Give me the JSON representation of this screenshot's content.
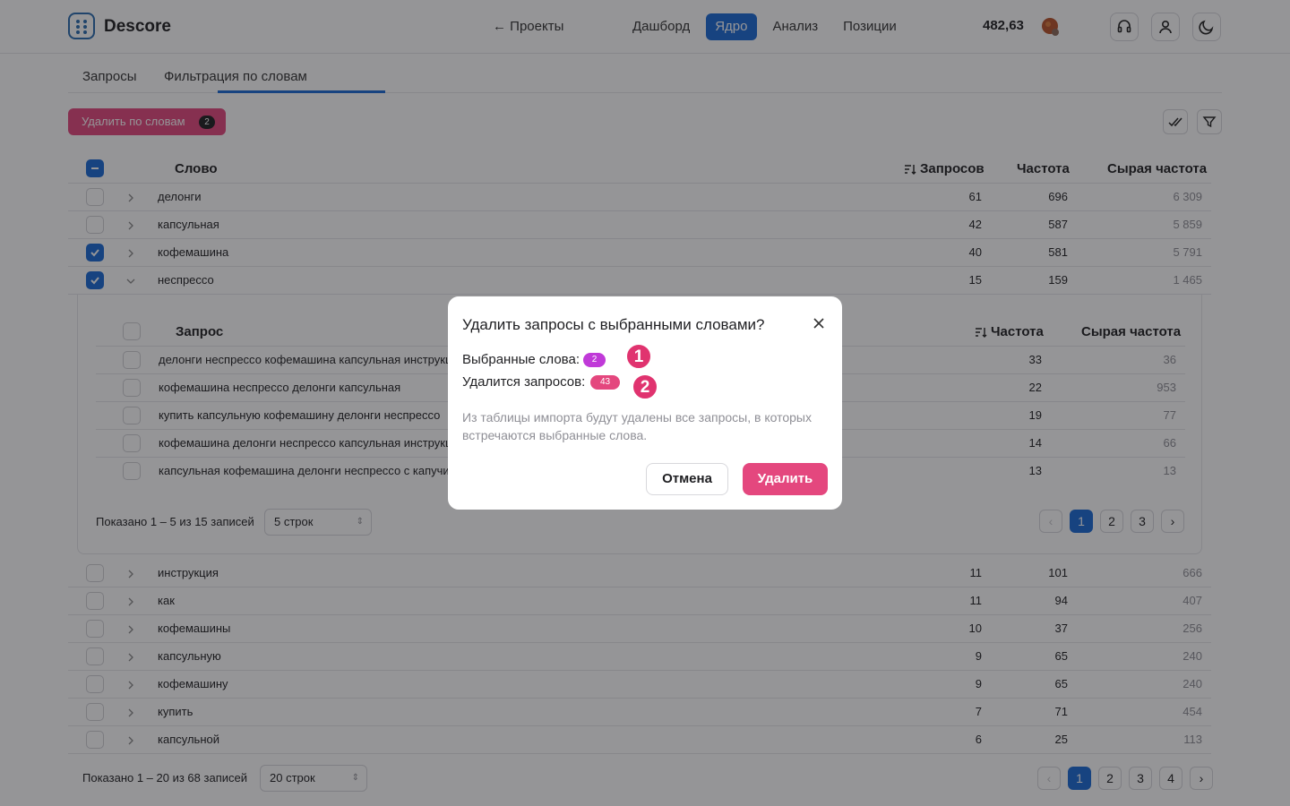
{
  "header": {
    "brand": "Descore",
    "back_link": "← Проекты",
    "nav": [
      "Дашборд",
      "Ядро",
      "Анализ",
      "Позиции"
    ],
    "active_nav": "Ядро",
    "balance": "482,63"
  },
  "tabs": [
    "Запросы",
    "Фильтрация по словам"
  ],
  "toolbar": {
    "delete_by_words": "Удалить по словам",
    "selected_count": "2"
  },
  "table": {
    "columns": {
      "word": "Слово",
      "queries": "Запросов",
      "freq": "Частота",
      "raw_freq": "Сырая частота"
    },
    "rows_top": [
      {
        "word": "делонги",
        "queries": "61",
        "freq": "696",
        "raw": "6 309",
        "checked": false
      },
      {
        "word": "капсульная",
        "queries": "42",
        "freq": "587",
        "raw": "5 859",
        "checked": false
      },
      {
        "word": "кофемашина",
        "queries": "40",
        "freq": "581",
        "raw": "5 791",
        "checked": true
      },
      {
        "word": "неспрессо",
        "queries": "15",
        "freq": "159",
        "raw": "1 465",
        "checked": true
      }
    ],
    "rows_bottom": [
      {
        "word": "инструкция",
        "queries": "11",
        "freq": "101",
        "raw": "666"
      },
      {
        "word": "как",
        "queries": "11",
        "freq": "94",
        "raw": "407"
      },
      {
        "word": "кофемашины",
        "queries": "10",
        "freq": "37",
        "raw": "256"
      },
      {
        "word": "капсульную",
        "queries": "9",
        "freq": "65",
        "raw": "240"
      },
      {
        "word": "кофемашину",
        "queries": "9",
        "freq": "65",
        "raw": "240"
      },
      {
        "word": "купить",
        "queries": "7",
        "freq": "71",
        "raw": "454"
      },
      {
        "word": "капсульной",
        "queries": "6",
        "freq": "25",
        "raw": "113"
      }
    ],
    "footer": {
      "shown": "Показано 1 – 20 из 68 записей",
      "rows_select": "20 строк",
      "pages": [
        "1",
        "2",
        "3",
        "4"
      ]
    }
  },
  "subtable": {
    "columns": {
      "query": "Запрос",
      "freq": "Частота",
      "raw_freq": "Сырая частота"
    },
    "rows": [
      {
        "query": "делонги неспрессо кофемашина капсульная инструкция",
        "freq": "33",
        "raw": "36"
      },
      {
        "query": "кофемашина неспрессо делонги капсульная",
        "freq": "22",
        "raw": "953"
      },
      {
        "query": "купить капсульную кофемашину делонги неспрессо",
        "freq": "19",
        "raw": "77"
      },
      {
        "query": "кофемашина делонги неспрессо капсульная инструкция",
        "freq": "14",
        "raw": "66"
      },
      {
        "query": "капсульная кофемашина делонги неспрессо с капучинатором",
        "freq": "13",
        "raw": "13"
      }
    ],
    "footer": {
      "shown": "Показано 1 – 5 из 15 записей",
      "rows_select": "5 строк",
      "pages": [
        "1",
        "2",
        "3"
      ]
    }
  },
  "modal": {
    "title": "Удалить запросы с выбранными словами?",
    "selected_words_label": "Выбранные слова:",
    "selected_words_count": "2",
    "delete_count_label": "Удалится запросов:",
    "delete_count": "43",
    "description": "Из таблицы импорта будут удалены все запросы, в которых встречаются выбранные слова.",
    "cancel": "Отмена",
    "confirm": "Удалить",
    "marker_1": "1",
    "marker_2": "2"
  },
  "colors": {
    "accent": "#1b6ad6",
    "danger": "#e4477e",
    "pill_words": "#c03ad8",
    "marker": "#e0336f"
  }
}
